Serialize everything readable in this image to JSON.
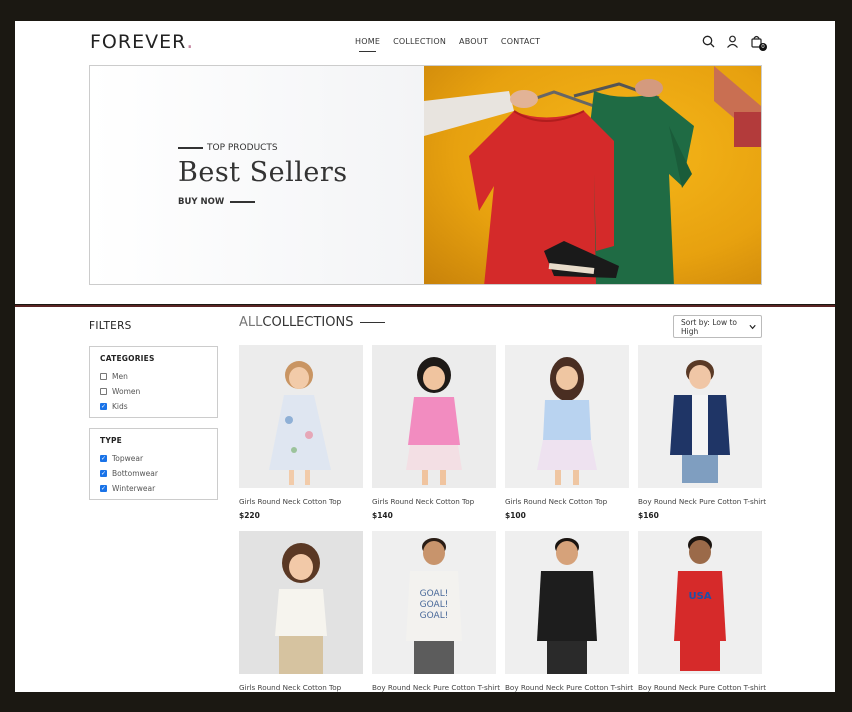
{
  "brand": {
    "name": "FOREVER",
    "dot": ".",
    "dot_color": "#c586a0"
  },
  "nav": [
    {
      "label": "HOME",
      "active": true
    },
    {
      "label": "COLLECTION",
      "active": false
    },
    {
      "label": "ABOUT",
      "active": false
    },
    {
      "label": "CONTACT",
      "active": false
    }
  ],
  "icons": {
    "search": "search-icon",
    "profile": "user-icon",
    "cart": "shopping-bag-icon"
  },
  "cart": {
    "count": "0"
  },
  "hero": {
    "kicker": "TOP PRODUCTS",
    "title": "Best Sellers",
    "cta": "BUY NOW",
    "bg_color": "#f6b719"
  },
  "filters": {
    "title": "FILTERS",
    "categories": {
      "title": "CATEGORIES",
      "options": [
        {
          "label": "Men",
          "checked": false
        },
        {
          "label": "Women",
          "checked": false
        },
        {
          "label": "Kids",
          "checked": true
        }
      ]
    },
    "type": {
      "title": "TYPE",
      "options": [
        {
          "label": "Topwear",
          "checked": true
        },
        {
          "label": "Bottomwear",
          "checked": true
        },
        {
          "label": "Winterwear",
          "checked": true
        }
      ]
    }
  },
  "collection": {
    "title_light": "ALL",
    "title_bold": "COLLECTIONS",
    "sort_label": "Sort by: Low to High"
  },
  "products": [
    {
      "name": "Girls Round Neck Cotton Top",
      "price": "$220"
    },
    {
      "name": "Girls Round Neck Cotton Top",
      "price": "$140"
    },
    {
      "name": "Girls Round Neck Cotton Top",
      "price": "$100"
    },
    {
      "name": "Boy Round Neck Pure Cotton T-shirt",
      "price": "$160"
    },
    {
      "name": "Girls Round Neck Cotton Top",
      "price": ""
    },
    {
      "name": "Boy Round Neck Pure Cotton T-shirt",
      "price": ""
    },
    {
      "name": "Boy Round Neck Pure Cotton T-shirt",
      "price": ""
    },
    {
      "name": "Boy Round Neck Pure Cotton T-shirt",
      "price": ""
    }
  ]
}
